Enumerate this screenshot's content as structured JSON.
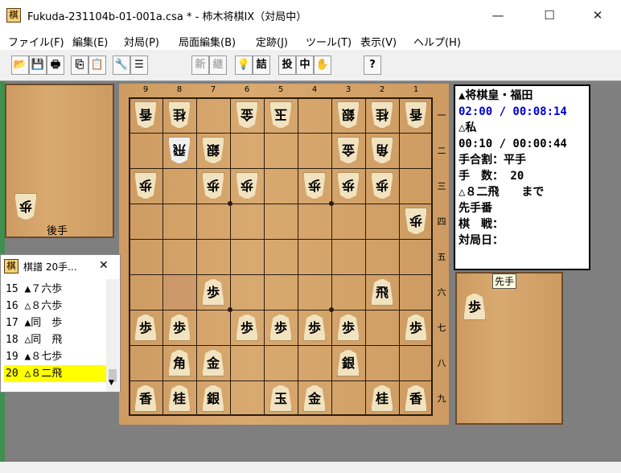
{
  "window": {
    "title": "Fukuda-231104b-01-001a.csa * - 柿木将棋IX（対局中）",
    "minimize": "—",
    "maximize": "☐",
    "close": "✕"
  },
  "menu": [
    "ファイル(F)",
    "編集(E)",
    "対局(P)",
    "局面編集(B)",
    "定跡(J)",
    "ツール(T)",
    "表示(V)",
    "ヘルプ(H)"
  ],
  "toolbar": {
    "open": "📂",
    "save": "💾",
    "print": "🖶",
    "copy": "⎘",
    "paste": "📋",
    "settings": "🔧",
    "list": "☰",
    "new": "新",
    "continue": "継",
    "hint": "💡",
    "tsume": "詰",
    "resign": "投",
    "interrupt": "中",
    "hand": "✋",
    "help": "?"
  },
  "board": {
    "file_labels": [
      "9",
      "8",
      "7",
      "6",
      "5",
      "4",
      "3",
      "2",
      "1"
    ],
    "rank_labels": [
      "一",
      "二",
      "三",
      "四",
      "五",
      "六",
      "七",
      "八",
      "九"
    ],
    "gote_label": "後手",
    "sente_label": "先手",
    "pieces": [
      {
        "r": 0,
        "f": 0,
        "k": "香",
        "g": true
      },
      {
        "r": 0,
        "f": 1,
        "k": "桂",
        "g": true
      },
      {
        "r": 0,
        "f": 3,
        "k": "金",
        "g": true
      },
      {
        "r": 0,
        "f": 4,
        "k": "玉",
        "g": true
      },
      {
        "r": 0,
        "f": 6,
        "k": "銀",
        "g": true
      },
      {
        "r": 0,
        "f": 7,
        "k": "桂",
        "g": true
      },
      {
        "r": 0,
        "f": 8,
        "k": "香",
        "g": true
      },
      {
        "r": 1,
        "f": 1,
        "k": "飛",
        "g": true,
        "h": true
      },
      {
        "r": 1,
        "f": 2,
        "k": "銀",
        "g": true
      },
      {
        "r": 1,
        "f": 6,
        "k": "金",
        "g": true
      },
      {
        "r": 1,
        "f": 7,
        "k": "角",
        "g": true
      },
      {
        "r": 2,
        "f": 0,
        "k": "歩",
        "g": true
      },
      {
        "r": 2,
        "f": 2,
        "k": "歩",
        "g": true
      },
      {
        "r": 2,
        "f": 3,
        "k": "歩",
        "g": true
      },
      {
        "r": 2,
        "f": 5,
        "k": "歩",
        "g": true
      },
      {
        "r": 2,
        "f": 6,
        "k": "歩",
        "g": true
      },
      {
        "r": 2,
        "f": 7,
        "k": "歩",
        "g": true
      },
      {
        "r": 3,
        "f": 8,
        "k": "歩",
        "g": true
      },
      {
        "r": 5,
        "f": 2,
        "k": "歩",
        "g": false
      },
      {
        "r": 5,
        "f": 7,
        "k": "飛",
        "g": false
      },
      {
        "r": 6,
        "f": 0,
        "k": "歩",
        "g": false
      },
      {
        "r": 6,
        "f": 1,
        "k": "歩",
        "g": false
      },
      {
        "r": 6,
        "f": 3,
        "k": "歩",
        "g": false
      },
      {
        "r": 6,
        "f": 4,
        "k": "歩",
        "g": false
      },
      {
        "r": 6,
        "f": 5,
        "k": "歩",
        "g": false
      },
      {
        "r": 6,
        "f": 6,
        "k": "歩",
        "g": false
      },
      {
        "r": 6,
        "f": 8,
        "k": "歩",
        "g": false
      },
      {
        "r": 7,
        "f": 1,
        "k": "角",
        "g": false
      },
      {
        "r": 7,
        "f": 2,
        "k": "金",
        "g": false
      },
      {
        "r": 7,
        "f": 6,
        "k": "銀",
        "g": false
      },
      {
        "r": 8,
        "f": 0,
        "k": "香",
        "g": false
      },
      {
        "r": 8,
        "f": 1,
        "k": "桂",
        "g": false
      },
      {
        "r": 8,
        "f": 2,
        "k": "銀",
        "g": false
      },
      {
        "r": 8,
        "f": 4,
        "k": "玉",
        "g": false
      },
      {
        "r": 8,
        "f": 5,
        "k": "金",
        "g": false
      },
      {
        "r": 8,
        "f": 7,
        "k": "桂",
        "g": false
      },
      {
        "r": 8,
        "f": 8,
        "k": "香",
        "g": false
      }
    ],
    "gote_hand": [
      "歩"
    ],
    "sente_hand": [
      "歩"
    ]
  },
  "info": {
    "sente_name": "▲将棋皇・福田",
    "sente_time": "02:00 / 00:08:14",
    "gote_name": "△私",
    "gote_time": "00:10 / 00:00:44",
    "handicap": "手合割：平手",
    "moves": "手　数： 20",
    "last_move": "△８二飛　　まで",
    "turn": "先手番",
    "event": "棋　戦：",
    "date": "対局日："
  },
  "kifu": {
    "title": "棋譜 20手...",
    "close": "✕",
    "entries": [
      "15 ▲７六歩",
      "16 △８六歩",
      "17 ▲同　歩",
      "18 △同　飛",
      "19 ▲８七歩",
      "20 △８二飛"
    ],
    "selected": 5
  }
}
